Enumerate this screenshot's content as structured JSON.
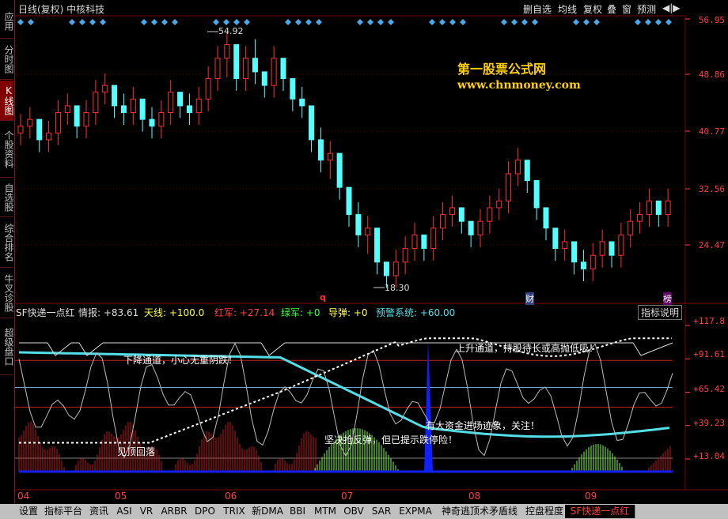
{
  "window": {
    "title": "日线(复权)  中核科技",
    "toolbar": [
      "删自选",
      "均线",
      "复权",
      "叠",
      "窗",
      "预测"
    ],
    "arrows": "◀|▶"
  },
  "sidebar": [
    "应用",
    "分时图",
    "K线图",
    "个股资料",
    "自选股",
    "综合排名",
    "牛叉诊股",
    "超级盘口"
  ],
  "sidebar_active": 2,
  "price_axis": [
    "56.95",
    "48.86",
    "40.77",
    "32.56",
    "24.47"
  ],
  "watermark": {
    "line1": "第一股票公式网",
    "line2": "www.chnmoney.com"
  },
  "price_marks": {
    "high": "54.92",
    "low": "18.30",
    "q": "q",
    "cai": "财",
    "bang": "榜"
  },
  "indicator": {
    "name": "SF快递一点红",
    "qingbao": "情报: +83.61",
    "tianxian": "天线: +100.0",
    "hongjun": "红军: +27.14",
    "lvjun": "绿军: +0",
    "daodan": "导弹: +0",
    "yujing": "预警系统: +60.00",
    "explain_btn": "指标说明"
  },
  "indicator_axis": [
    "+117.8",
    "+91.61",
    "+65.42",
    "+39.23",
    "+13.04"
  ],
  "annotations": {
    "a1": "下降通道，小心无重阴跌！",
    "a2": "上升通道，持股待长或高抛低吸！",
    "a3": "有大资金进场迹象，关注！",
    "a4": "坚决抢反弹，但已提示跌停险！",
    "a5": "见顶回落"
  },
  "dates": [
    "04",
    "05",
    "06",
    "07",
    "08",
    "09"
  ],
  "bottom_tabs": [
    "设置",
    "指标平台",
    "资讯",
    "ASI",
    "VR",
    "ARBR",
    "DPO",
    "TRIX",
    "新DMA",
    "BBI",
    "MTM",
    "OBV",
    "SAR",
    "EXPMA",
    "神奇逃顶术矛盾线",
    "控盘程度",
    "SF快递一点红"
  ],
  "bottom_active": 16,
  "colors": {
    "up": "#ff3030",
    "down": "#54ffff",
    "grid": "#800000",
    "ma": "#54dfe8",
    "green": "#7cff3c"
  },
  "chart_data": {
    "type": "candlestick",
    "price_high": 54.92,
    "price_low": 18.3,
    "candles": [
      [
        40,
        42,
        39,
        41
      ],
      [
        41,
        43,
        40,
        42
      ],
      [
        42,
        41,
        38,
        39
      ],
      [
        39,
        41,
        38,
        40
      ],
      [
        40,
        44,
        39,
        43
      ],
      [
        43,
        45,
        42,
        44
      ],
      [
        44,
        43,
        40,
        41
      ],
      [
        41,
        44,
        40,
        43
      ],
      [
        43,
        47,
        42,
        46
      ],
      [
        46,
        48,
        45,
        47
      ],
      [
        47,
        46,
        43,
        44
      ],
      [
        44,
        45,
        42,
        43
      ],
      [
        43,
        46,
        42,
        45
      ],
      [
        45,
        44,
        41,
        42
      ],
      [
        42,
        43,
        40,
        41
      ],
      [
        41,
        44,
        40,
        43
      ],
      [
        43,
        47,
        42,
        46
      ],
      [
        46,
        45,
        43,
        44
      ],
      [
        44,
        45,
        42,
        43
      ],
      [
        43,
        46,
        42,
        45
      ],
      [
        45,
        49,
        44,
        48
      ],
      [
        48,
        52,
        47,
        51
      ],
      [
        51,
        54,
        49,
        53
      ],
      [
        53,
        50,
        47,
        48
      ],
      [
        48,
        52,
        47,
        51
      ],
      [
        51,
        53,
        48,
        49
      ],
      [
        49,
        48,
        46,
        47
      ],
      [
        47,
        52,
        46,
        51
      ],
      [
        51,
        50,
        47,
        48
      ],
      [
        48,
        47,
        44,
        45
      ],
      [
        45,
        46,
        43,
        44
      ],
      [
        44,
        42,
        38,
        39
      ],
      [
        39,
        40,
        35,
        36
      ],
      [
        36,
        38,
        34,
        37
      ],
      [
        37,
        35,
        31,
        32
      ],
      [
        32,
        31,
        27,
        28
      ],
      [
        28,
        29,
        24,
        25
      ],
      [
        25,
        27,
        23,
        26
      ],
      [
        26,
        24,
        20,
        21
      ],
      [
        21,
        19,
        18,
        19
      ],
      [
        19,
        22,
        18,
        21
      ],
      [
        21,
        24,
        20,
        23
      ],
      [
        23,
        26,
        22,
        25
      ],
      [
        25,
        24,
        22,
        23
      ],
      [
        23,
        27,
        22,
        26
      ],
      [
        26,
        29,
        25,
        28
      ],
      [
        28,
        30,
        27,
        29
      ],
      [
        29,
        28,
        26,
        27
      ],
      [
        27,
        26,
        24,
        25
      ],
      [
        25,
        28,
        24,
        27
      ],
      [
        27,
        30,
        26,
        29
      ],
      [
        29,
        31,
        28,
        30
      ],
      [
        30,
        35,
        29,
        34
      ],
      [
        34,
        37,
        33,
        36
      ],
      [
        36,
        35,
        32,
        33
      ],
      [
        33,
        31,
        28,
        29
      ],
      [
        29,
        27,
        25,
        26
      ],
      [
        26,
        25,
        22,
        23
      ],
      [
        23,
        25,
        22,
        24
      ],
      [
        24,
        23,
        20,
        21
      ],
      [
        21,
        22,
        19,
        20
      ],
      [
        20,
        23,
        19,
        22
      ],
      [
        22,
        25,
        21,
        24
      ],
      [
        24,
        23,
        21,
        22
      ],
      [
        22,
        26,
        21,
        25
      ],
      [
        25,
        28,
        24,
        27
      ],
      [
        27,
        29,
        26,
        28
      ],
      [
        28,
        31,
        27,
        30
      ],
      [
        30,
        29,
        27,
        28
      ],
      [
        28,
        31,
        27,
        30
      ]
    ]
  }
}
